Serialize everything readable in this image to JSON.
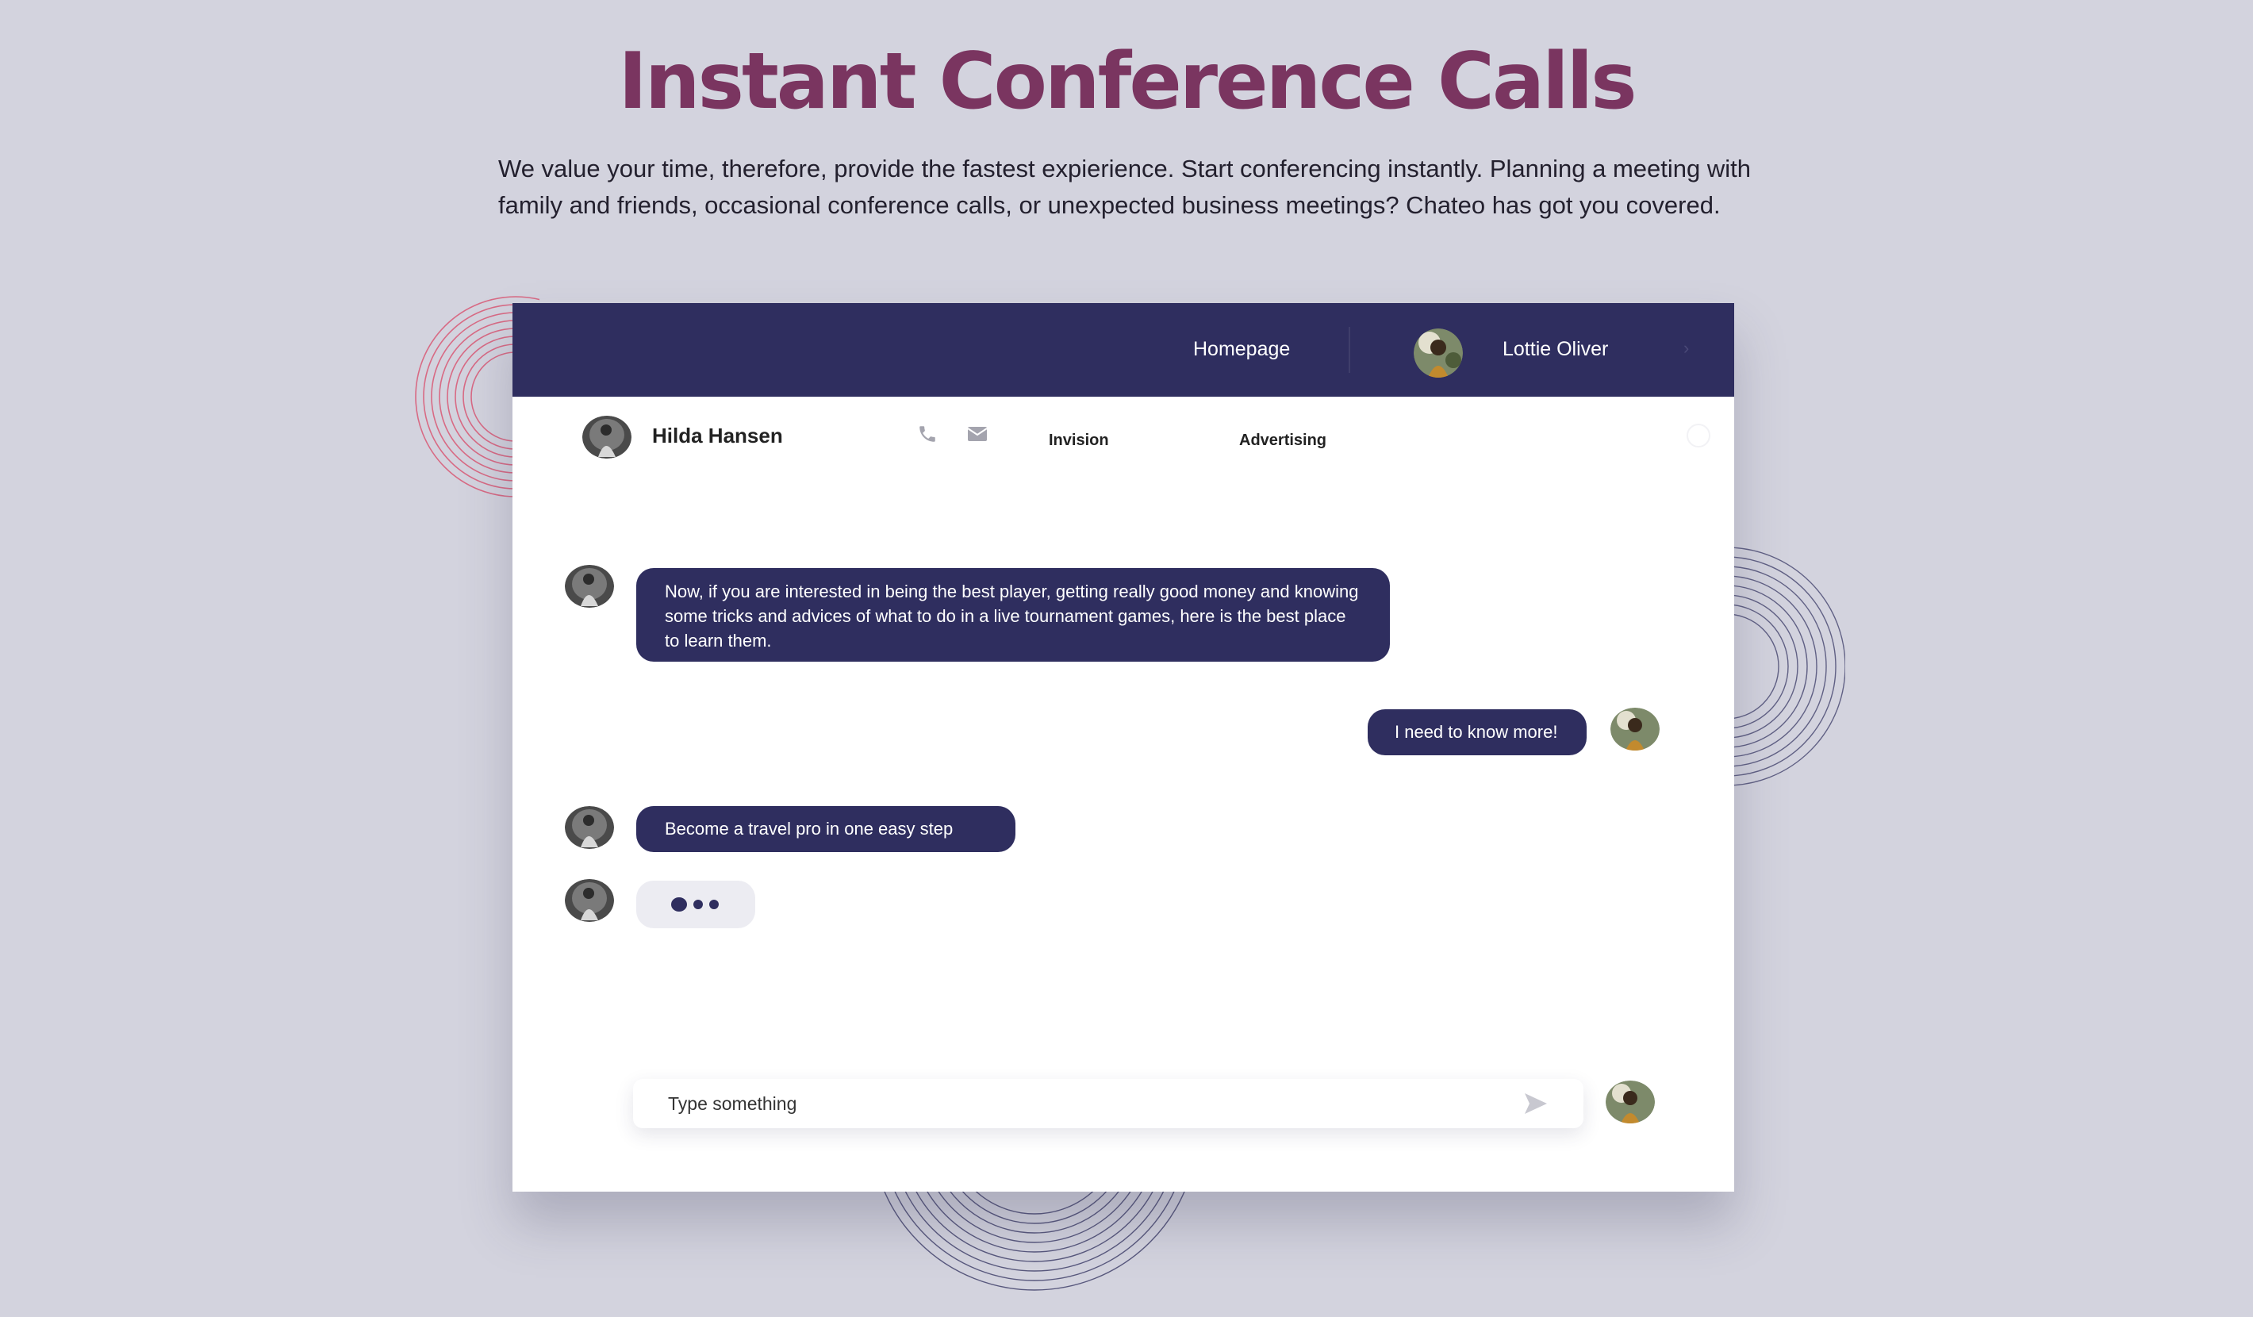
{
  "hero": {
    "title": "Instant Conference Calls",
    "description": "We value your time, therefore, provide the fastest expierience. Start conferencing instantly. Planning a meeting with family and friends, occasional conference calls, or unexpected business meetings? Chateo has got you covered."
  },
  "app": {
    "topbar": {
      "nav_homepage": "Homepage",
      "user_name": "Lottie Oliver"
    },
    "chat_header": {
      "contact_name": "Hilda Hansen",
      "tabs": [
        "Invision",
        "Advertising"
      ]
    },
    "messages": [
      {
        "from": "contact",
        "text": "Now, if you are interested in being the best player, getting really good money and knowing some tricks and advices of what to do in a live tournament games, here is the best place to learn them."
      },
      {
        "from": "me",
        "text": "I need to know more!"
      },
      {
        "from": "contact",
        "text": "Become a travel pro in one easy step"
      }
    ],
    "composer": {
      "placeholder": "Type something"
    }
  },
  "colors": {
    "page_bg": "#d3d3de",
    "title": "#7a3560",
    "brand_navy": "#2f2e5f",
    "ring_red": "#d86a84",
    "ring_navy": "#3a3a66"
  },
  "icons": [
    "phone-icon",
    "mail-icon",
    "send-icon",
    "chevron-right-icon",
    "typing-indicator"
  ]
}
